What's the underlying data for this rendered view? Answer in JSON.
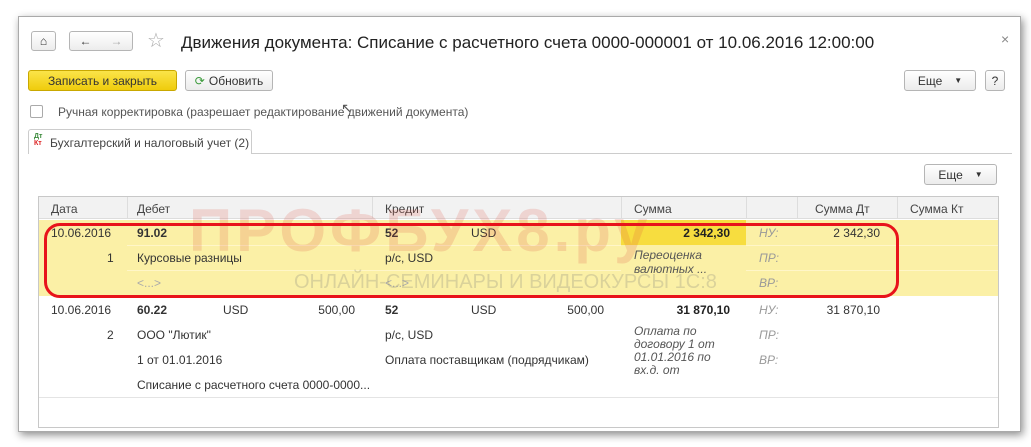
{
  "window": {
    "title": "Движения документа: Списание с расчетного счета 0000-000001 от 10.06.2016 12:00:00",
    "close": "×"
  },
  "toolbar": {
    "save_close": "Записать и закрыть",
    "refresh": "Обновить",
    "more": "Еще",
    "help": "?"
  },
  "manual": {
    "label": "Ручная корректировка (разрешает редактирование движений документа)"
  },
  "tab": {
    "label": "Бухгалтерский и налоговый учет (2)",
    "icon_dt": "Дт",
    "icon_kt": "Кт"
  },
  "table": {
    "more": "Еще",
    "columns": [
      "Дата",
      "Дебет",
      "Кредит",
      "Сумма",
      "Сумма Дт",
      "Сумма Кт"
    ],
    "rows": [
      {
        "date": "10.06.2016",
        "num": "1",
        "debit": "91.02",
        "debit_cur": "",
        "debit_amt": "",
        "debit_sub1": "Курсовые разницы",
        "debit_sub2": "<...>",
        "debit_sub3": "",
        "credit": "52",
        "credit_cur": "USD",
        "credit_amt": "",
        "credit_sub1": "р/с, USD",
        "credit_sub2": "<...>",
        "sum": "2 342,30",
        "content": "Переоценка валютных ...",
        "nu": "НУ:",
        "pr": "ПР:",
        "vr": "ВР:",
        "sum_dt": "2 342,30",
        "sum_kt": ""
      },
      {
        "date": "10.06.2016",
        "num": "2",
        "debit": "60.22",
        "debit_cur": "USD",
        "debit_amt": "500,00",
        "debit_sub1": "ООО \"Лютик\"",
        "debit_sub2": "1 от 01.01.2016",
        "debit_sub3": "Списание с расчетного счета 0000-0000...",
        "credit": "52",
        "credit_cur": "USD",
        "credit_amt": "500,00",
        "credit_sub1": "р/с, USD",
        "credit_sub2": "Оплата поставщикам (подрядчикам)",
        "sum": "31 870,10",
        "content": "Оплата по договору 1 от 01.01.2016 по вх.д.  от",
        "nu": "НУ:",
        "pr": "ПР:",
        "vr": "ВР:",
        "sum_dt": "31 870,10",
        "sum_kt": ""
      }
    ]
  },
  "watermark": {
    "brand": "ПРОФБУХ8.ру",
    "tagline": "ОНЛАЙН-СЕМИНАРЫ И ВИДЕОКУРСЫ 1С:8"
  },
  "colors": {
    "primary": "#f5d91c",
    "highlight": "#fbf0a6",
    "selected": "#f7dd3f",
    "annotation": "#e8131b"
  }
}
